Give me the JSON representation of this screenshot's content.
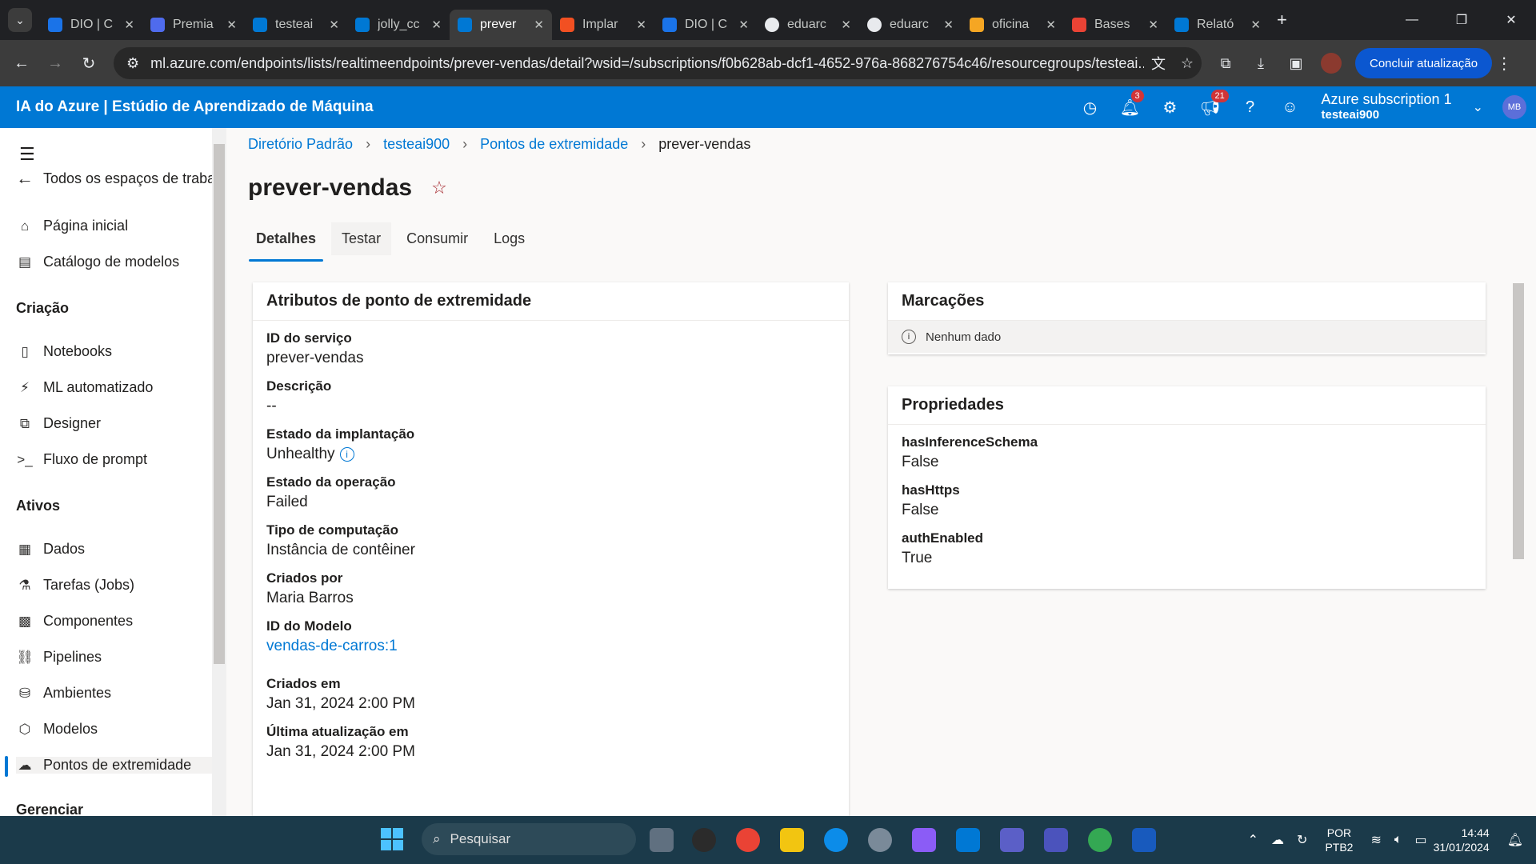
{
  "browser": {
    "tabs": [
      {
        "title": "DIO | C",
        "color": "#1a73e8"
      },
      {
        "title": "Premia",
        "color": "#4f6bed"
      },
      {
        "title": "testeai",
        "color": "#0078d4"
      },
      {
        "title": "jolly_cc",
        "color": "#0078d4"
      },
      {
        "title": "prever",
        "color": "#0078d4",
        "active": true
      },
      {
        "title": "Implar",
        "color": "#f25022"
      },
      {
        "title": "DIO | C",
        "color": "#1a73e8"
      },
      {
        "title": "eduarc",
        "color": "#e8eaed"
      },
      {
        "title": "eduarc",
        "color": "#e8eaed"
      },
      {
        "title": "oficina",
        "color": "#f5a623"
      },
      {
        "title": "Bases",
        "color": "#ea4335"
      },
      {
        "title": "Relató",
        "color": "#0078d4"
      }
    ],
    "url": "ml.azure.com/endpoints/lists/realtimeendpoints/prever-vendas/detail?wsid=/subscriptions/f0b628ab-dcf1-4652-976a-868276754c46/resourcegroups/testeai...",
    "update_label": "Concluir atualização"
  },
  "app": {
    "title": "IA do Azure | Estúdio de Aprendizado de Máquina",
    "notif_count": "3",
    "feedback_count": "21",
    "subscription": "Azure subscription 1",
    "workspace": "testeai900",
    "avatar": "MB"
  },
  "sidebar": {
    "back": "Todos os espaços de trabal",
    "home": "Página inicial",
    "catalog": "Catálogo de modelos",
    "section_create": "Criação",
    "notebooks": "Notebooks",
    "automl": "ML automatizado",
    "designer": "Designer",
    "promptflow": "Fluxo de prompt",
    "section_assets": "Ativos",
    "data": "Dados",
    "jobs": "Tarefas (Jobs)",
    "components": "Componentes",
    "pipelines": "Pipelines",
    "environments": "Ambientes",
    "models": "Modelos",
    "endpoints": "Pontos de extremidade",
    "section_manage": "Gerenciar"
  },
  "breadcrumb": {
    "dir": "Diretório Padrão",
    "ws": "testeai900",
    "endpoints": "Pontos de extremidade",
    "current": "prever-vendas"
  },
  "page": {
    "title": "prever-vendas",
    "tabs": [
      "Detalhes",
      "Testar",
      "Consumir",
      "Logs"
    ]
  },
  "attributes": {
    "header": "Atributos de ponto de extremidade",
    "service_id_label": "ID do serviço",
    "service_id": "prever-vendas",
    "description_label": "Descrição",
    "description": "--",
    "deploy_state_label": "Estado da implantação",
    "deploy_state": "Unhealthy",
    "op_state_label": "Estado da operação",
    "op_state": "Failed",
    "compute_label": "Tipo de computação",
    "compute": "Instância de contêiner",
    "created_by_label": "Criados por",
    "created_by": "Maria Barros",
    "model_id_label": "ID do Modelo",
    "model_id": "vendas-de-carros:1",
    "created_at_label": "Criados em",
    "created_at": "Jan 31, 2024 2:00 PM",
    "updated_at_label": "Última atualização em",
    "updated_at": "Jan 31, 2024 2:00 PM"
  },
  "tags": {
    "header": "Marcações",
    "empty": "Nenhum dado"
  },
  "properties": {
    "header": "Propriedades",
    "items": [
      {
        "key": "hasInferenceSchema",
        "value": "False"
      },
      {
        "key": "hasHttps",
        "value": "False"
      },
      {
        "key": "authEnabled",
        "value": "True"
      }
    ]
  },
  "taskbar": {
    "search": "Pesquisar",
    "lang1": "POR",
    "lang2": "PTB2",
    "time": "14:44",
    "date": "31/01/2024"
  }
}
